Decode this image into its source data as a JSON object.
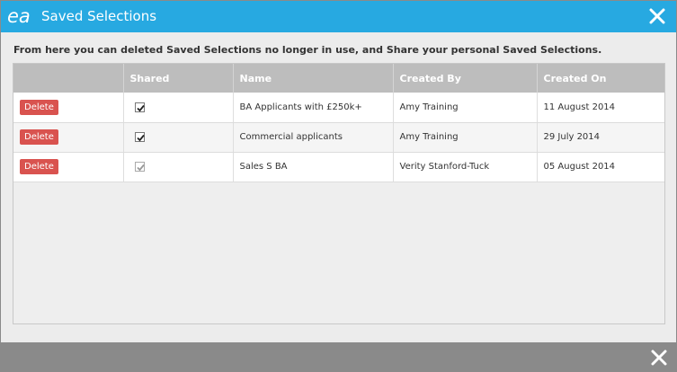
{
  "dialog": {
    "title": "Saved Selections",
    "logo_text": "ea",
    "intro_text": "From here you can deleted Saved Selections no longer in use, and Share your personal Saved Selections.",
    "colors": {
      "titlebar": "#27a9e1",
      "delete": "#d9534f",
      "footer": "#8a8a8a"
    }
  },
  "table": {
    "columns": [
      "",
      "Shared",
      "Name",
      "Created By",
      "Created On"
    ],
    "rows": [
      {
        "delete_label": "Delete",
        "shared": true,
        "shared_enabled": true,
        "name": "BA Applicants with £250k+",
        "created_by": "Amy Training",
        "created_on": "11 August 2014"
      },
      {
        "delete_label": "Delete",
        "shared": true,
        "shared_enabled": true,
        "name": "Commercial applicants",
        "created_by": "Amy Training",
        "created_on": "29 July 2014"
      },
      {
        "delete_label": "Delete",
        "shared": true,
        "shared_enabled": false,
        "name": "Sales S BA",
        "created_by": "Verity Stanford-Tuck",
        "created_on": "05 August 2014"
      }
    ]
  },
  "icons": {
    "close_top": "close-icon",
    "close_bottom": "close-icon",
    "logo": "ea-logo"
  }
}
